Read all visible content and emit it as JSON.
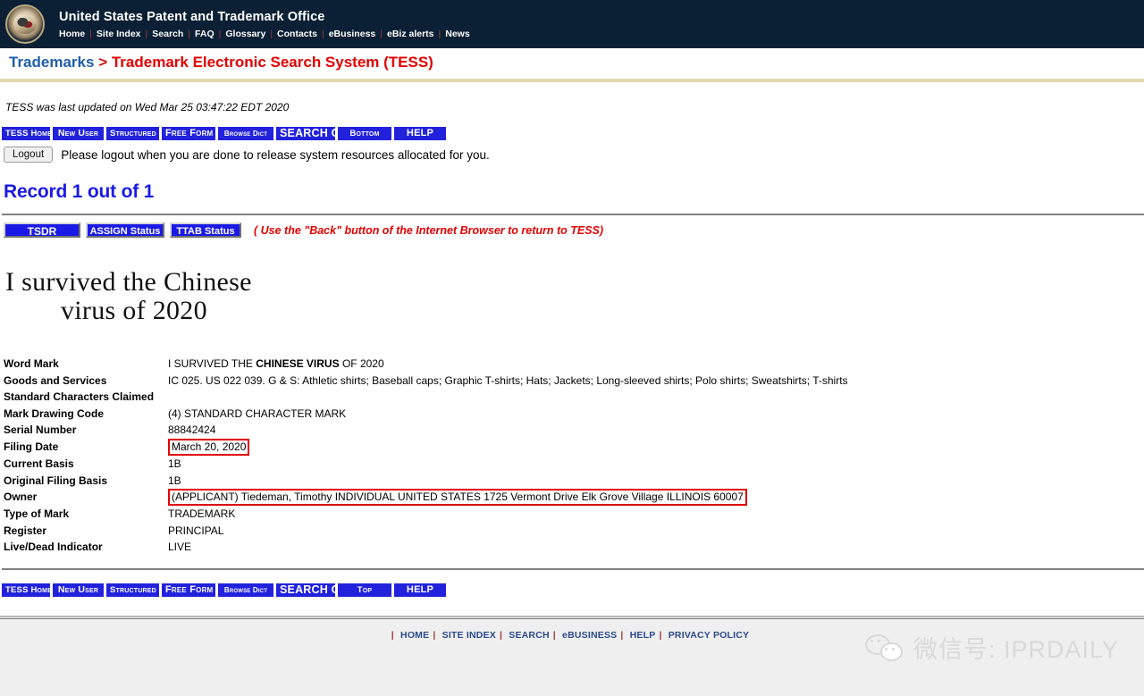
{
  "banner": {
    "seal_icon": "uspto-seal-icon",
    "agency_title": "United States Patent and Trademark Office",
    "nav_links": [
      "Home",
      "Site Index",
      "Search",
      "FAQ",
      "Glossary",
      "Contacts",
      "eBusiness",
      "eBiz alerts",
      "News"
    ]
  },
  "breadcrumb": {
    "parent": "Trademarks",
    "separator": ">",
    "current": "Trademark Electronic Search System (TESS)"
  },
  "status_line": {
    "updated_text": "TESS was last updated on Wed Mar 25 03:47:22 EDT 2020"
  },
  "toolbar_top": {
    "buttons": [
      "TESS Home",
      "New User",
      "Structured",
      "Free Form",
      "Browse Dict",
      "SEARCH OG",
      "Bottom",
      "HELP"
    ]
  },
  "logout": {
    "button_label": "Logout",
    "note": "Please logout when you are done to release system resources allocated for you."
  },
  "record": {
    "heading": "Record 1 out of 1"
  },
  "status_buttons": {
    "tsdr": "TSDR",
    "assign": "ASSIGN Status",
    "ttab": "TTAB Status",
    "back_note": "( Use the \"Back\" button of the Internet Browser to return to TESS)"
  },
  "mark_drawing": {
    "line1": "I survived the Chinese",
    "line2": "virus of 2020"
  },
  "fields": [
    {
      "label": "Word Mark",
      "value_prefix": "I SURVIVED THE ",
      "value_bold": "CHINESE VIRUS",
      "value_suffix": " OF 2020",
      "boxed": false
    },
    {
      "label": "Goods and Services",
      "value": "IC 025. US 022 039. G & S: Athletic shirts; Baseball caps; Graphic T-shirts; Hats; Jackets; Long-sleeved shirts; Polo shirts; Sweatshirts; T-shirts",
      "boxed": false
    },
    {
      "label": "Standard Characters Claimed",
      "value": "",
      "boxed": false
    },
    {
      "label": "Mark Drawing Code",
      "value": "(4) STANDARD CHARACTER MARK",
      "boxed": false
    },
    {
      "label": "Serial Number",
      "value": "88842424",
      "boxed": false
    },
    {
      "label": "Filing Date",
      "value": "March 20, 2020",
      "boxed": true
    },
    {
      "label": "Current Basis",
      "value": "1B",
      "boxed": false
    },
    {
      "label": "Original Filing Basis",
      "value": "1B",
      "boxed": false
    },
    {
      "label": "Owner",
      "value": "(APPLICANT) Tiedeman, Timothy INDIVIDUAL UNITED STATES 1725 Vermont Drive Elk Grove Village ILLINOIS 60007",
      "boxed": true
    },
    {
      "label": "Type of Mark",
      "value": "TRADEMARK",
      "boxed": false
    },
    {
      "label": "Register",
      "value": "PRINCIPAL",
      "boxed": false
    },
    {
      "label": "Live/Dead Indicator",
      "value": "LIVE",
      "boxed": false
    }
  ],
  "toolbar_bottom": {
    "buttons": [
      "TESS Home",
      "New User",
      "Structured",
      "Free Form",
      "Browse Dict",
      "SEARCH OG",
      "Top",
      "HELP"
    ]
  },
  "footer": {
    "links": [
      "HOME",
      "SITE INDEX",
      "SEARCH",
      "eBUSINESS",
      "HELP",
      "PRIVACY POLICY"
    ]
  },
  "watermark": {
    "icon": "wechat-icon",
    "text": "微信号: IPRDAILY"
  },
  "colors": {
    "banner_bg": "#0b2034",
    "accent_blue": "#1f5fa9",
    "accent_red": "#e30000",
    "button_blue": "#2222dd",
    "gold_rule": "#e5d7ad",
    "highlight_box": "#e00000",
    "footer_bg": "#efefef"
  }
}
